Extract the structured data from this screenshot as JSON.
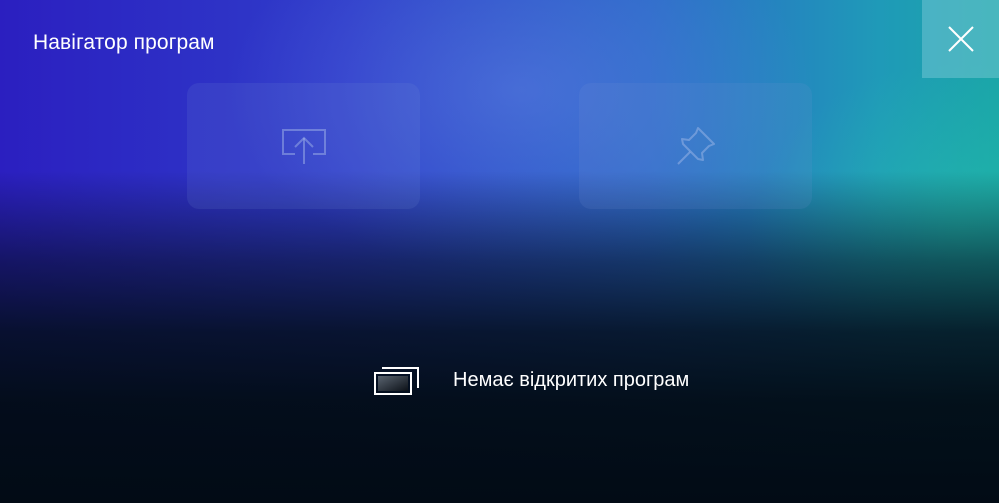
{
  "window": {
    "title": "Навігатор програм"
  },
  "colors": {
    "gradient_start": "#2b1fc0",
    "gradient_mid": "#2b6ac8",
    "gradient_end": "#1aa5a8",
    "bottom": "#020b15",
    "text": "#ffffff"
  },
  "toolbar": {
    "close_icon": "close-icon",
    "actions": [
      {
        "icon": "share-screen-icon"
      },
      {
        "icon": "pin-icon"
      }
    ]
  },
  "empty_state": {
    "icon": "windows-stack-icon",
    "message": "Немає відкритих програм"
  }
}
